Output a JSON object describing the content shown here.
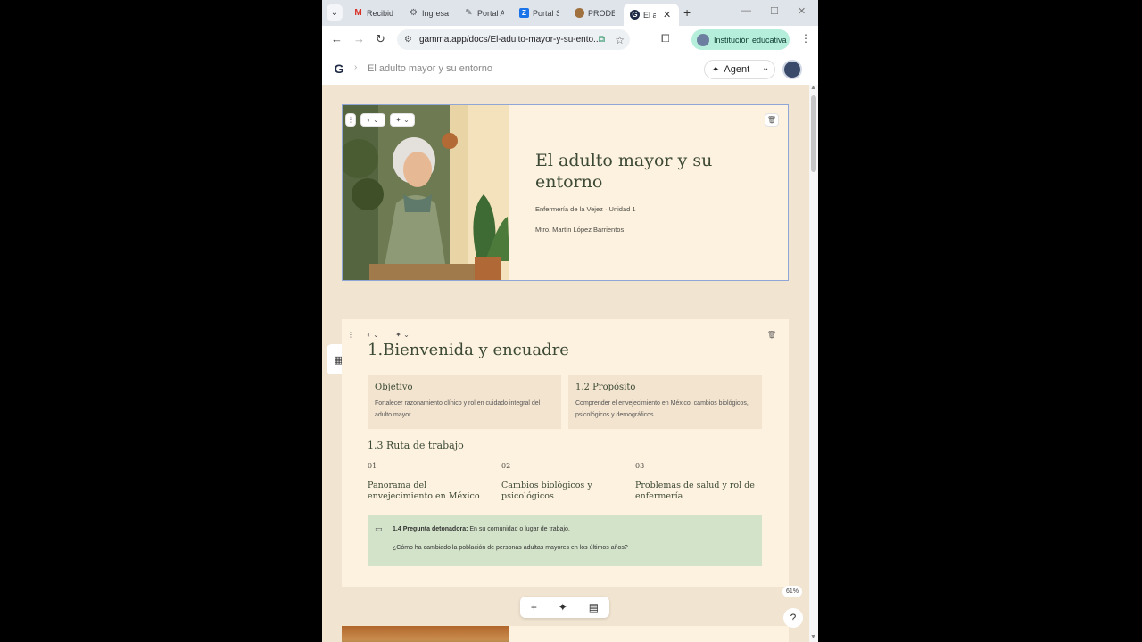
{
  "browser": {
    "tabs": [
      {
        "label": "Recibid",
        "icon": "gmail-icon",
        "color": "#d93025"
      },
      {
        "label": "Ingresa",
        "icon": "gear-icon",
        "color": "#5f6368"
      },
      {
        "label": "Portal A",
        "icon": "portal-icon",
        "color": "#5f6368"
      },
      {
        "label": "Portal S",
        "icon": "portal-s-icon",
        "color": "#1a73e8"
      },
      {
        "label": "PRODE",
        "icon": "prode-icon",
        "color": "#a0703e"
      },
      {
        "label": "El a",
        "icon": "gamma-icon",
        "color": "#1f2a44"
      }
    ],
    "url": "gamma.app/docs/El-adulto-mayor-y-su-ento...",
    "profile_label": "Institución educativa"
  },
  "app": {
    "breadcrumb": "El adulto mayor y su entorno",
    "agent_label": "Agent",
    "logo": "G"
  },
  "card1": {
    "title": "El adulto mayor y su entorno",
    "subtitle": "Enfermería de la Vejez · Unidad 1",
    "author": "Mtro. Martín López Barrientos"
  },
  "card2": {
    "title": "1.Bienvenida y encuadre",
    "box_left": {
      "heading": "Objetivo",
      "text": "Fortalecer razonamiento clínico y rol en cuidado integral del adulto mayor"
    },
    "box_right": {
      "heading": "1.2 Propósito",
      "text": "Comprender el envejecimiento en México: cambios biológicos, psicológicos y demográficos"
    },
    "ruta_title": "1.3 Ruta de trabajo",
    "steps": [
      {
        "num": "01",
        "label": "Panorama del envejecimiento en México"
      },
      {
        "num": "02",
        "label": "Cambios biológicos y psicológicos"
      },
      {
        "num": "03",
        "label": "Problemas de salud y rol de enfermería"
      }
    ],
    "callout": {
      "prefix": "1.4",
      "bold": "Pregunta detonadora:",
      "line1_rest": "En su comunidad o lugar de trabajo,",
      "line2": "¿Cómo ha cambiado la población de personas adultas mayores en los últimos años?"
    }
  },
  "zoom": "61%",
  "colors": {
    "canvas_bg": "#f1e4d1",
    "card_bg": "#fdf1e0",
    "heading": "#3c4a35",
    "callout_bg": "#d3e3c9",
    "profile_pill": "#b6eedc"
  }
}
